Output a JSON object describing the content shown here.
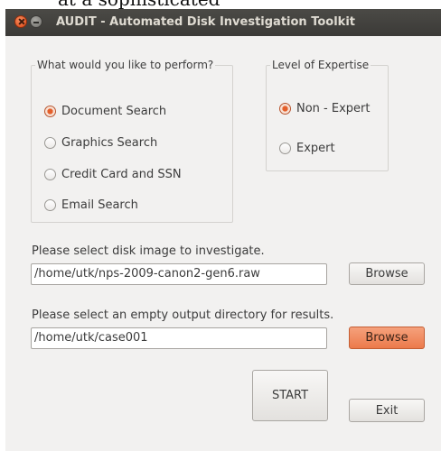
{
  "caption": {
    "text": "at a sophisticated"
  },
  "window": {
    "title": "AUDIT - Automated Disk Investigation Toolkit"
  },
  "perform_group": {
    "legend": "What would you like to perform?",
    "options": [
      {
        "label": "Document Search",
        "checked": true
      },
      {
        "label": "Graphics Search",
        "checked": false
      },
      {
        "label": "Credit Card and SSN",
        "checked": false
      },
      {
        "label": "Email Search",
        "checked": false
      }
    ]
  },
  "expertise_group": {
    "legend": "Level of Expertise",
    "options": [
      {
        "label": "Non - Expert",
        "checked": true
      },
      {
        "label": "Expert",
        "checked": false
      }
    ]
  },
  "disk_image": {
    "label": "Please select disk image to investigate.",
    "value": "/home/utk/nps-2009-canon2-gen6.raw",
    "browse_label": "Browse"
  },
  "output_dir": {
    "label": "Please select an empty output directory for results.",
    "value": "/home/utk/case001",
    "browse_label": "Browse"
  },
  "actions": {
    "start_label": "START",
    "exit_label": "Exit"
  },
  "colors": {
    "accent": "#e9753f",
    "titlebar": "#3c3b37",
    "window_bg": "#f2f1f0"
  }
}
